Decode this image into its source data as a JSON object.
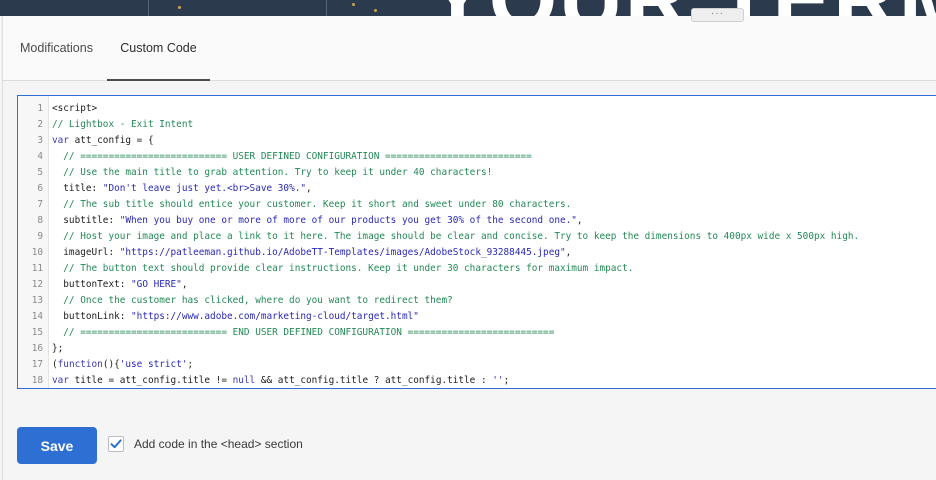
{
  "banner": {
    "text": "YOUR TERMS"
  },
  "tabs": [
    {
      "label": "Modifications",
      "active": false
    },
    {
      "label": "Custom Code",
      "active": true
    }
  ],
  "grabber": {
    "icon": "ellipsis-icon",
    "glyph": "···"
  },
  "editor": {
    "lines": [
      {
        "n": "1",
        "segments": [
          {
            "t": "<script>",
            "c": "plain"
          }
        ]
      },
      {
        "n": "2",
        "segments": [
          {
            "t": "// Lightbox - Exit Intent",
            "c": "comment"
          }
        ]
      },
      {
        "n": "3",
        "segments": [
          {
            "t": "var",
            "c": "keyword"
          },
          {
            "t": " att_config = {",
            "c": "plain"
          }
        ]
      },
      {
        "n": "4",
        "segments": [
          {
            "t": "  // ========================== USER DEFINED CONFIGURATION ==========================",
            "c": "comment"
          }
        ]
      },
      {
        "n": "5",
        "segments": [
          {
            "t": "  // Use the main title to grab attention. Try to keep it under 40 characters!",
            "c": "comment"
          }
        ]
      },
      {
        "n": "6",
        "segments": [
          {
            "t": "  title: ",
            "c": "plain"
          },
          {
            "t": "\"Don't leave just yet.<br>Save 30%.\"",
            "c": "string"
          },
          {
            "t": ",",
            "c": "plain"
          }
        ]
      },
      {
        "n": "7",
        "segments": [
          {
            "t": "  // The sub title should entice your customer. Keep it short and sweet under 80 characters.",
            "c": "comment"
          }
        ]
      },
      {
        "n": "8",
        "segments": [
          {
            "t": "  subtitle: ",
            "c": "plain"
          },
          {
            "t": "\"When you buy one or more of more of our products you get 30% of the second one.\"",
            "c": "string"
          },
          {
            "t": ",",
            "c": "plain"
          }
        ]
      },
      {
        "n": "9",
        "segments": [
          {
            "t": "  // Host your image and place a link to it here. The image should be clear and concise. Try to keep the dimensions to 400px wide x 500px high.",
            "c": "comment"
          }
        ]
      },
      {
        "n": "10",
        "segments": [
          {
            "t": "  imageUrl: ",
            "c": "plain"
          },
          {
            "t": "\"https://patleeman.github.io/AdobeTT-Templates/images/AdobeStock_93288445.jpeg\"",
            "c": "string"
          },
          {
            "t": ",",
            "c": "plain"
          }
        ]
      },
      {
        "n": "11",
        "segments": [
          {
            "t": "  // The button text should provide clear instructions. Keep it under 30 characters for maximum impact.",
            "c": "comment"
          }
        ]
      },
      {
        "n": "12",
        "segments": [
          {
            "t": "  buttonText: ",
            "c": "plain"
          },
          {
            "t": "\"GO HERE\"",
            "c": "string"
          },
          {
            "t": ",",
            "c": "plain"
          }
        ]
      },
      {
        "n": "13",
        "segments": [
          {
            "t": "  // Once the customer has clicked, where do you want to redirect them?",
            "c": "comment"
          }
        ]
      },
      {
        "n": "14",
        "segments": [
          {
            "t": "  buttonLink: ",
            "c": "plain"
          },
          {
            "t": "\"https://www.adobe.com/marketing-cloud/target.html\"",
            "c": "string"
          }
        ]
      },
      {
        "n": "15",
        "segments": [
          {
            "t": "  // ========================== END USER DEFINED CONFIGURATION ==========================",
            "c": "comment"
          }
        ]
      },
      {
        "n": "16",
        "segments": [
          {
            "t": "};",
            "c": "plain"
          }
        ]
      },
      {
        "n": "17",
        "segments": [
          {
            "t": "(",
            "c": "plain"
          },
          {
            "t": "function",
            "c": "keyword"
          },
          {
            "t": "(){",
            "c": "plain"
          },
          {
            "t": "'use strict'",
            "c": "string"
          },
          {
            "t": ";",
            "c": "plain"
          }
        ]
      },
      {
        "n": "18",
        "segments": [
          {
            "t": "var",
            "c": "keyword"
          },
          {
            "t": " title = att_config.title != ",
            "c": "plain"
          },
          {
            "t": "null",
            "c": "keyword"
          },
          {
            "t": " && att_config.title ? att_config.title : ",
            "c": "plain"
          },
          {
            "t": "''",
            "c": "string"
          },
          {
            "t": ";",
            "c": "plain"
          }
        ]
      }
    ]
  },
  "actions": {
    "save_label": "Save",
    "checkbox_label": "Add code in the <head> section",
    "checkbox_checked": true,
    "checkbox_icon": "checkmark-icon"
  },
  "colors": {
    "accent": "#2d6fd2",
    "comment": "#238a56",
    "string": "#2a29b5",
    "keyword": "#3a3ab8"
  }
}
